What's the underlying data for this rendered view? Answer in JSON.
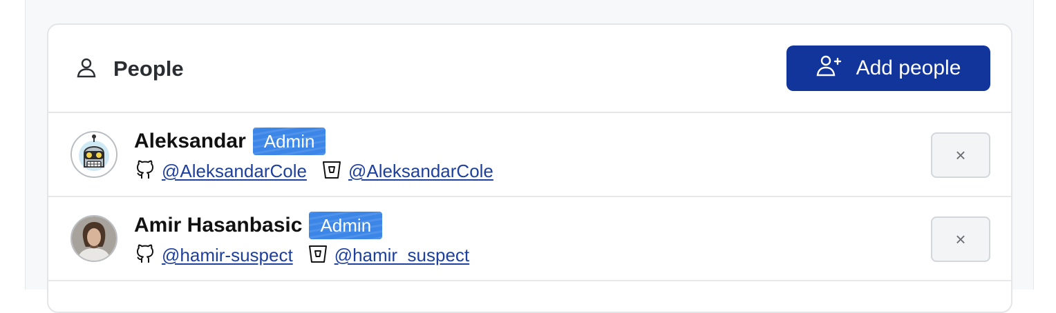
{
  "panel": {
    "title": "People",
    "title_icon": "person-icon",
    "add_button_label": "Add people",
    "add_button_icon": "person-add-icon",
    "accent_color": "#12359c",
    "badge_color": "#3c86e8"
  },
  "people": [
    {
      "name": "Aleksandar",
      "role": "Admin",
      "avatar": "robot-avatar",
      "github_handle": "@AleksandarCole",
      "bitbucket_handle": "@AleksandarCole",
      "remove_label": "×"
    },
    {
      "name": "Amir Hasanbasic",
      "role": "Admin",
      "avatar": "photo-avatar",
      "github_handle": "@hamir-suspect",
      "bitbucket_handle": "@hamir_suspect",
      "remove_label": "×"
    }
  ]
}
